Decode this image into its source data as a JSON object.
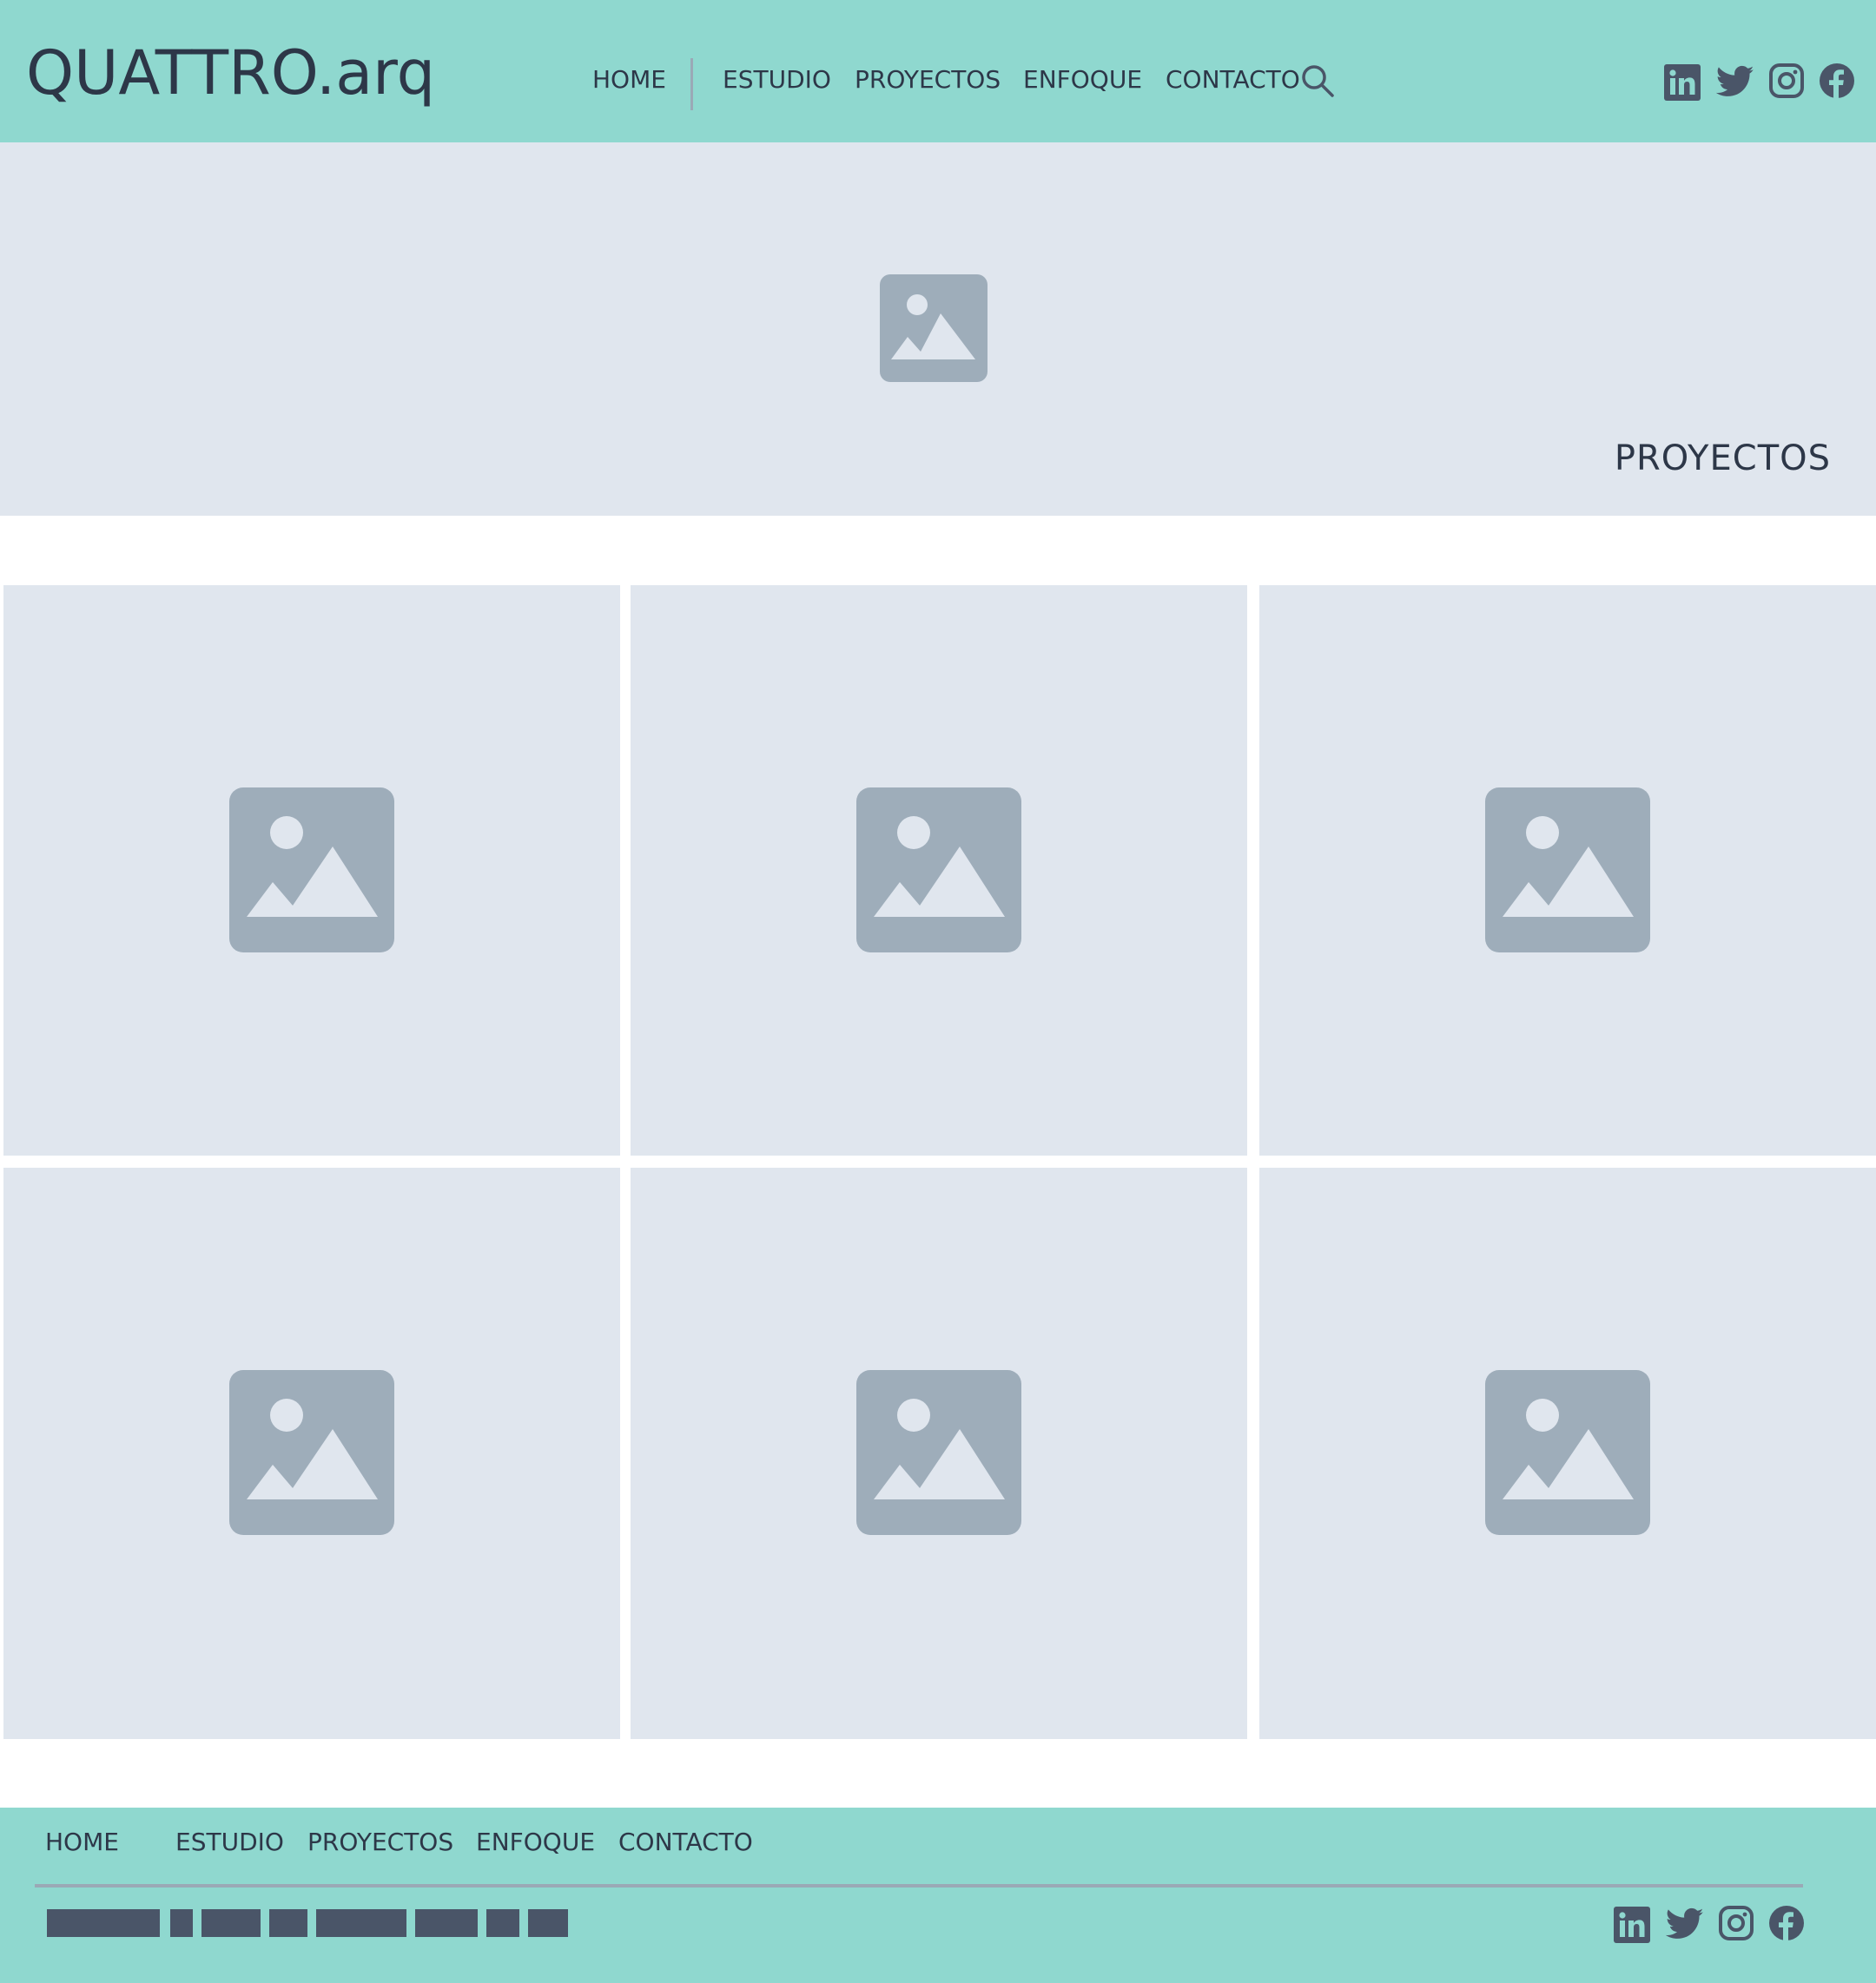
{
  "brand": {
    "logo_text": "QUATTRO.arq"
  },
  "header": {
    "nav": [
      {
        "label": "HOME"
      },
      {
        "label": "ESTUDIO"
      },
      {
        "label": "PROYECTOS"
      },
      {
        "label": "ENFOQUE"
      },
      {
        "label": "CONTACTO"
      }
    ],
    "search_icon": "search-icon",
    "social_icons": [
      "linkedin-icon",
      "twitter-icon",
      "instagram-icon",
      "facebook-icon"
    ]
  },
  "hero": {
    "title": "PROYECTOS",
    "image_icon": "image-placeholder-icon"
  },
  "projects": {
    "tiles": [
      {
        "image_icon": "image-placeholder-icon"
      },
      {
        "image_icon": "image-placeholder-icon"
      },
      {
        "image_icon": "image-placeholder-icon"
      },
      {
        "image_icon": "image-placeholder-icon"
      },
      {
        "image_icon": "image-placeholder-icon"
      },
      {
        "image_icon": "image-placeholder-icon"
      }
    ]
  },
  "footer": {
    "nav": [
      {
        "label": "HOME"
      },
      {
        "label": "ESTUDIO"
      },
      {
        "label": "PROYECTOS"
      },
      {
        "label": "ENFOQUE"
      },
      {
        "label": "CONTACTO"
      }
    ],
    "social_icons": [
      "linkedin-icon",
      "twitter-icon",
      "instagram-icon",
      "facebook-icon"
    ]
  },
  "colors": {
    "header_bg": "#8fd8cf",
    "placeholder_bg": "#e0e6ee",
    "placeholder_icon": "#9eadba",
    "text_dark": "#2d3748",
    "icon_dark": "#4a5568",
    "divider": "#9aa9b6"
  }
}
